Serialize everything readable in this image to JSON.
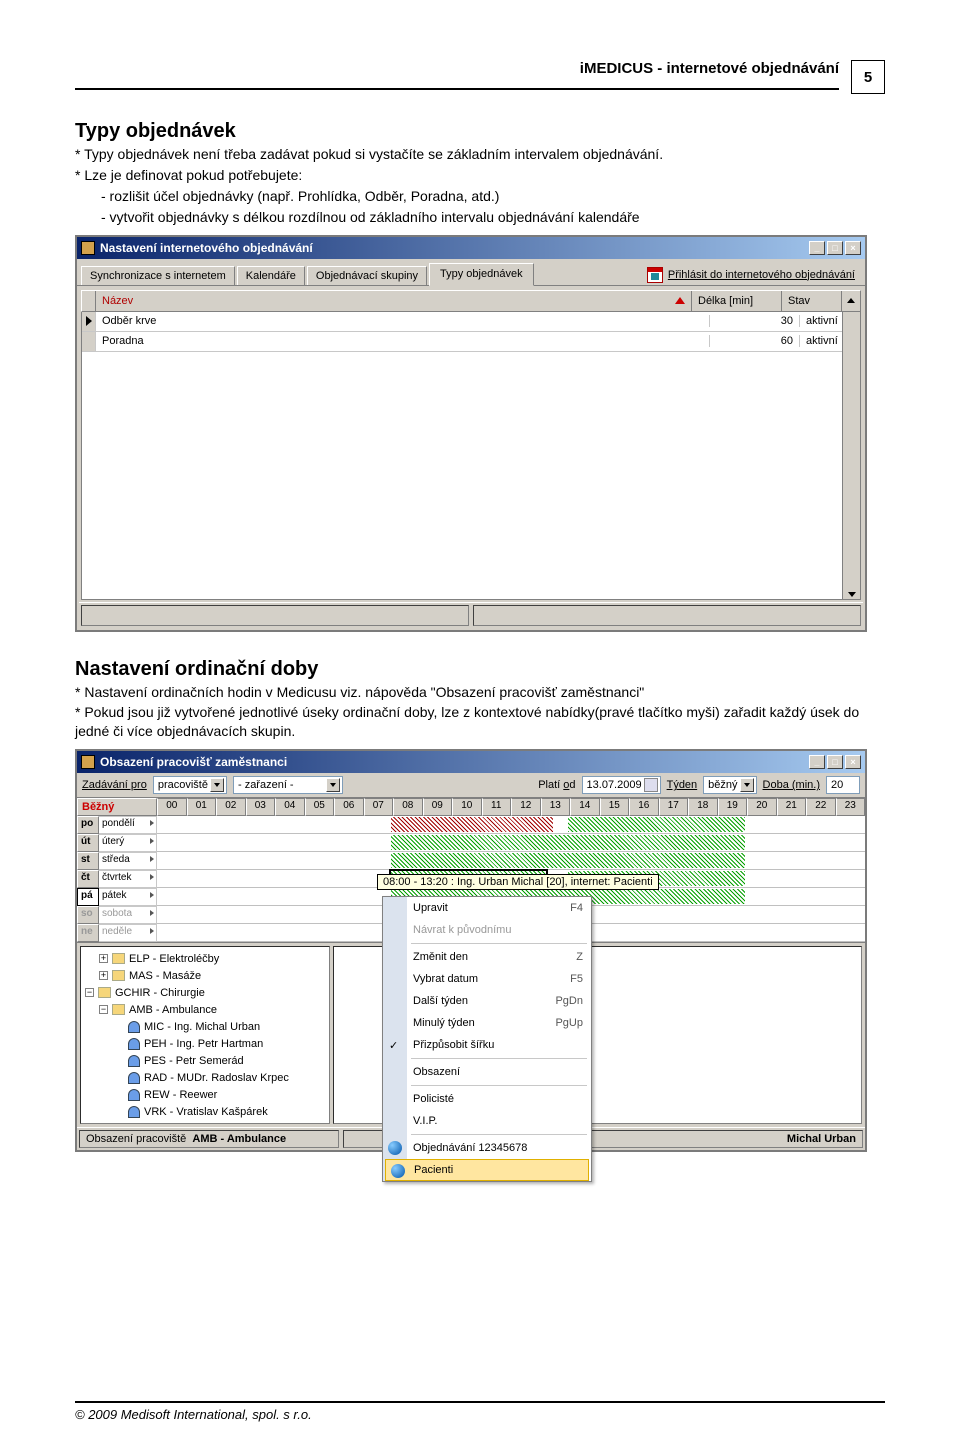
{
  "header": {
    "title": "iMEDICUS - internetové objednávání",
    "page_number": "5"
  },
  "section1": {
    "title": "Typy objednávek",
    "p1": "* Typy objednávek není třeba zadávat pokud si vystačíte se základním intervalem objednávání.",
    "p2": "* Lze je definovat pokud potřebujete:",
    "b1": "- rozlišit účel objednávky (např. Prohlídka, Odběr, Poradna, atd.)",
    "b2": "- vytvořit objednávky s délkou rozdílnou od základního intervalu objednávání kalendáře"
  },
  "win1": {
    "title": "Nastavení internetového objednávání",
    "tabs": [
      "Synchronizace s internetem",
      "Kalendáře",
      "Objednávací skupiny",
      "Typy objednávek"
    ],
    "active_tab": 3,
    "login_label": "Přihlásit do internetového objednávání",
    "columns": {
      "nazev": "Název",
      "delka": "Délka [min]",
      "stav": "Stav"
    },
    "rows": [
      {
        "nazev": "Odběr krve",
        "delka": "30",
        "stav": "aktivní"
      },
      {
        "nazev": "Poradna",
        "delka": "60",
        "stav": "aktivní"
      }
    ]
  },
  "section2": {
    "title": "Nastavení ordinační doby",
    "p1": "* Nastavení ordinačních hodin v Medicusu viz. nápověda \"Obsazení pracovišť zaměstnanci\"",
    "p2": "* Pokud jsou již vytvořené jednotlivé úseky ordinační doby, lze z kontextové nabídky(pravé tlačítko myši) zařadit každý úsek do jedné či více objednávacích skupin."
  },
  "win2": {
    "title": "Obsazení pracovišť zaměstnanci",
    "toolbar": {
      "zadavani_label": "Zadávání pro",
      "zadavani_value": "pracoviště",
      "zarazeni_value": "- zařazení -",
      "plati_label": "Platí od",
      "plati_value": "13.07.2009",
      "tyden_label": "Týden",
      "tyden_value": "běžný",
      "doba_label": "Doba (min.)",
      "doba_value": "20"
    },
    "corner": "Běžný",
    "hours": [
      "00",
      "01",
      "02",
      "03",
      "04",
      "05",
      "06",
      "07",
      "08",
      "09",
      "10",
      "11",
      "12",
      "13",
      "14",
      "15",
      "16",
      "17",
      "18",
      "19",
      "20",
      "21",
      "22",
      "23"
    ],
    "days": [
      {
        "abbr": "po",
        "name": "pondělí"
      },
      {
        "abbr": "út",
        "name": "úterý"
      },
      {
        "abbr": "st",
        "name": "středa"
      },
      {
        "abbr": "čt",
        "name": "čtvrtek"
      },
      {
        "abbr": "pá",
        "name": "pátek"
      },
      {
        "abbr": "so",
        "name": "sobota"
      },
      {
        "abbr": "ne",
        "name": "neděle"
      }
    ],
    "tooltip": "08:00 - 13:20 : Ing. Urban Michal [20], internet: Pacienti",
    "tree": [
      {
        "lvl": 1,
        "exp": "+",
        "icon": "folder",
        "label": "ELP - Elektroléčby"
      },
      {
        "lvl": 1,
        "exp": "+",
        "icon": "folder",
        "label": "MAS - Masáže"
      },
      {
        "lvl": 0,
        "exp": "−",
        "icon": "folder",
        "label": "GCHIR - Chirurgie"
      },
      {
        "lvl": 1,
        "exp": "−",
        "icon": "folder",
        "label": "AMB - Ambulance"
      },
      {
        "lvl": 2,
        "icon": "person",
        "label": "MIC - Ing. Michal Urban"
      },
      {
        "lvl": 2,
        "icon": "person",
        "label": "PEH - Ing. Petr Hartman"
      },
      {
        "lvl": 2,
        "icon": "person",
        "label": "PES - Petr Semerád"
      },
      {
        "lvl": 2,
        "icon": "person",
        "label": "RAD - MUDr. Radoslav Krpec"
      },
      {
        "lvl": 2,
        "icon": "person",
        "label": "REW - Reewer"
      },
      {
        "lvl": 2,
        "icon": "person",
        "label": "VRK - Vratislav Kašpárek"
      }
    ],
    "context_menu": [
      {
        "label": "Upravit",
        "shortcut": "F4",
        "type": "item"
      },
      {
        "label": "Návrat k původnímu",
        "shortcut": "",
        "type": "disabled"
      },
      {
        "type": "sep"
      },
      {
        "label": "Změnit den",
        "shortcut": "Z",
        "type": "item"
      },
      {
        "label": "Vybrat datum",
        "shortcut": "F5",
        "type": "item"
      },
      {
        "label": "Další týden",
        "shortcut": "PgDn",
        "type": "item"
      },
      {
        "label": "Minulý týden",
        "shortcut": "PgUp",
        "type": "item"
      },
      {
        "label": "Přizpůsobit šířku",
        "shortcut": "",
        "type": "checked"
      },
      {
        "type": "sep"
      },
      {
        "label": "Obsazení",
        "shortcut": "",
        "type": "item"
      },
      {
        "type": "sep"
      },
      {
        "label": "Policisté",
        "shortcut": "",
        "type": "item"
      },
      {
        "label": "V.I.P.",
        "shortcut": "",
        "type": "item"
      },
      {
        "type": "sep"
      },
      {
        "label": "Objednávání 12345678",
        "shortcut": "",
        "type": "globe"
      },
      {
        "label": "Pacienti",
        "shortcut": "",
        "type": "selected-globe"
      }
    ],
    "status": {
      "left_label": "Obsazení pracoviště",
      "left_value": "AMB - Ambulance",
      "right_value": "Michal Urban"
    }
  },
  "footer": "© 2009 Medisoft International, spol. s r.o."
}
